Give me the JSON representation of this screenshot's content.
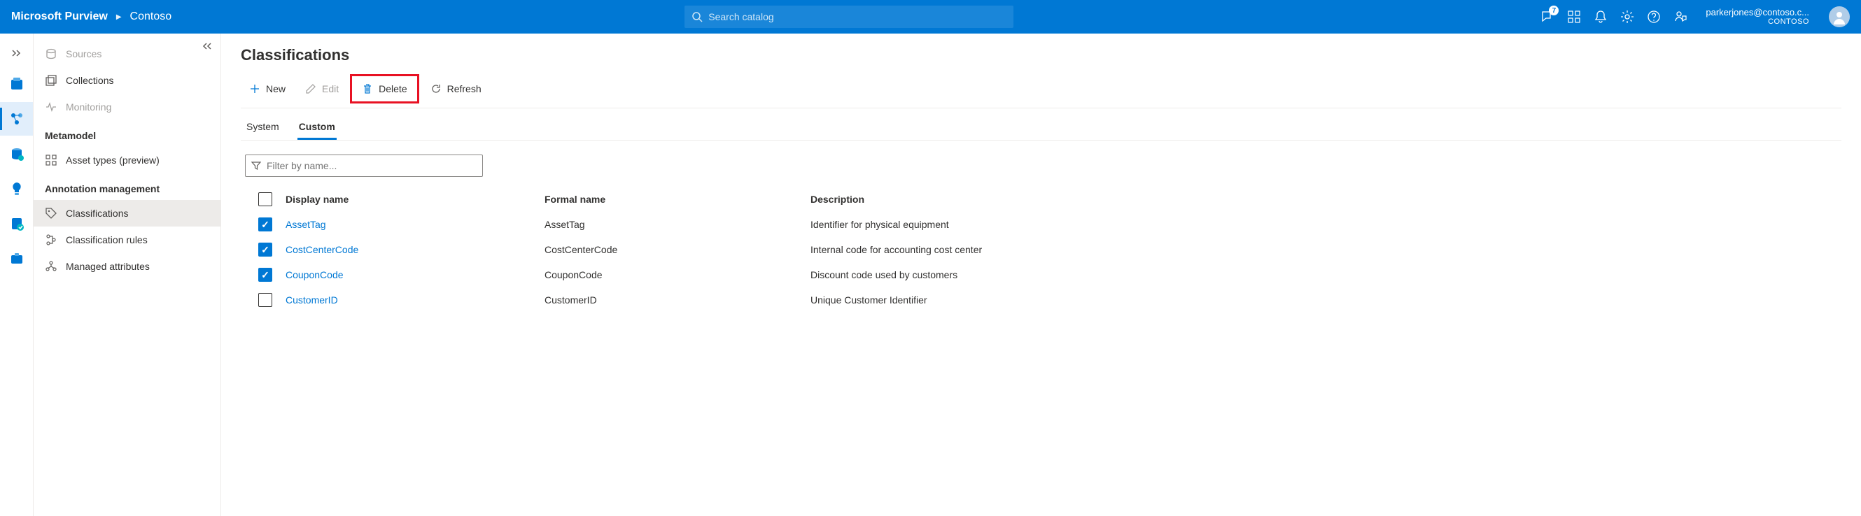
{
  "header": {
    "app_name": "Microsoft Purview",
    "breadcrumb": "Contoso",
    "search_placeholder": "Search catalog",
    "badge_count": "7",
    "user_email": "parkerjones@contoso.c...",
    "user_org": "CONTOSO"
  },
  "sidebar": {
    "items": [
      {
        "label": "Sources",
        "icon": "sources",
        "disabled": true
      },
      {
        "label": "Collections",
        "icon": "collections"
      },
      {
        "label": "Monitoring",
        "icon": "monitoring",
        "disabled": true
      }
    ],
    "heading1": "Metamodel",
    "meta_items": [
      {
        "label": "Asset types (preview)",
        "icon": "asset-types"
      }
    ],
    "heading2": "Annotation management",
    "annotation_items": [
      {
        "label": "Classifications",
        "icon": "classifications",
        "active": true
      },
      {
        "label": "Classification rules",
        "icon": "rules"
      },
      {
        "label": "Managed attributes",
        "icon": "attributes"
      }
    ]
  },
  "page": {
    "title": "Classifications",
    "toolbar": {
      "new_label": "New",
      "edit_label": "Edit",
      "delete_label": "Delete",
      "refresh_label": "Refresh"
    },
    "tabs": {
      "system": "System",
      "custom": "Custom"
    },
    "filter_placeholder": "Filter by name...",
    "columns": {
      "display": "Display name",
      "formal": "Formal name",
      "desc": "Description"
    },
    "rows": [
      {
        "display": "AssetTag",
        "formal": "AssetTag",
        "desc": "Identifier for physical equipment",
        "checked": true
      },
      {
        "display": "CostCenterCode",
        "formal": "CostCenterCode",
        "desc": "Internal code for accounting cost center",
        "checked": true
      },
      {
        "display": "CouponCode",
        "formal": "CouponCode",
        "desc": "Discount code used by customers",
        "checked": true
      },
      {
        "display": "CustomerID",
        "formal": "CustomerID",
        "desc": "Unique Customer Identifier",
        "checked": false
      }
    ]
  }
}
